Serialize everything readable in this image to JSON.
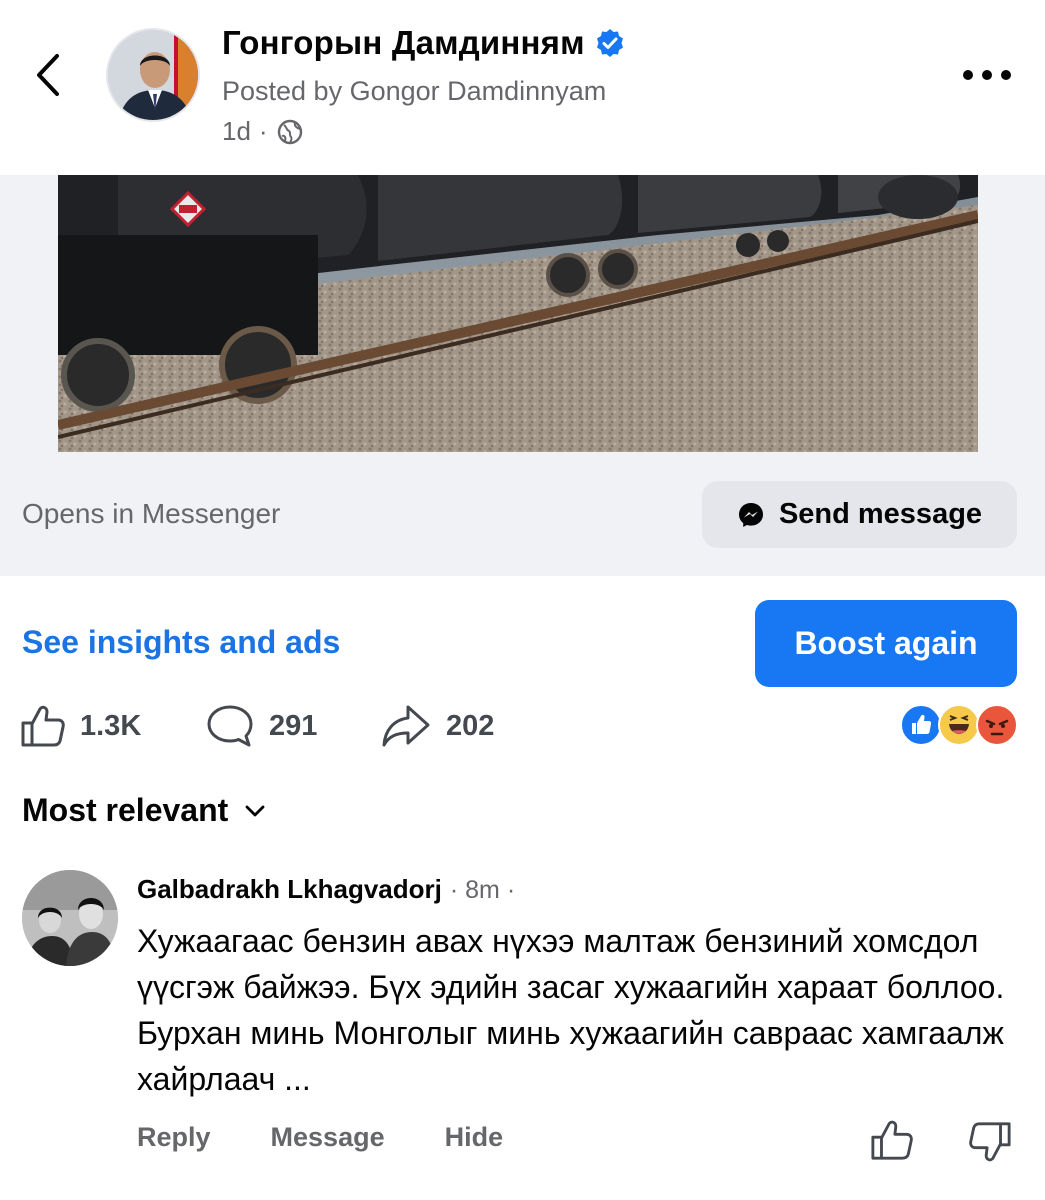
{
  "header": {
    "author_name": "Гонгорын Дамдинням",
    "posted_by": "Posted by Gongor Damdinnyam",
    "time": "1d",
    "separator": "·",
    "icons": {
      "back": "chevron-left-icon",
      "verified": "verified-badge-icon",
      "privacy": "globe-icon",
      "more": "more-horizontal-icon"
    }
  },
  "messenger_bar": {
    "opens_label": "Opens in Messenger",
    "send_button_label": "Send message",
    "icon": "messenger-icon"
  },
  "promo": {
    "insights_link": "See insights and ads",
    "boost_button_label": "Boost again"
  },
  "stats": {
    "likes": "1.3K",
    "comments": "291",
    "shares": "202",
    "reactions": [
      "like",
      "haha",
      "angry"
    ]
  },
  "sort": {
    "label": "Most relevant"
  },
  "comment": {
    "author": "Galbadrakh Lkhagvadorj",
    "time": "· 8m ·",
    "text": "Хужаагаас бензин авах нүхээ малтаж бензиний хомсдол үүсгэж байжээ. Бүх эдийн засаг хужаагийн хараат боллоо. Бурхан минь Монголыг минь хужаагийн савраас хамгаалж хайрлаач ...",
    "actions": {
      "reply": "Reply",
      "message": "Message",
      "hide": "Hide"
    }
  },
  "colors": {
    "accent": "#1877f2",
    "link": "#1b74e4",
    "secondary_text": "#65676b",
    "surface": "#f0f2f5",
    "button_gray": "#e4e6eb"
  }
}
